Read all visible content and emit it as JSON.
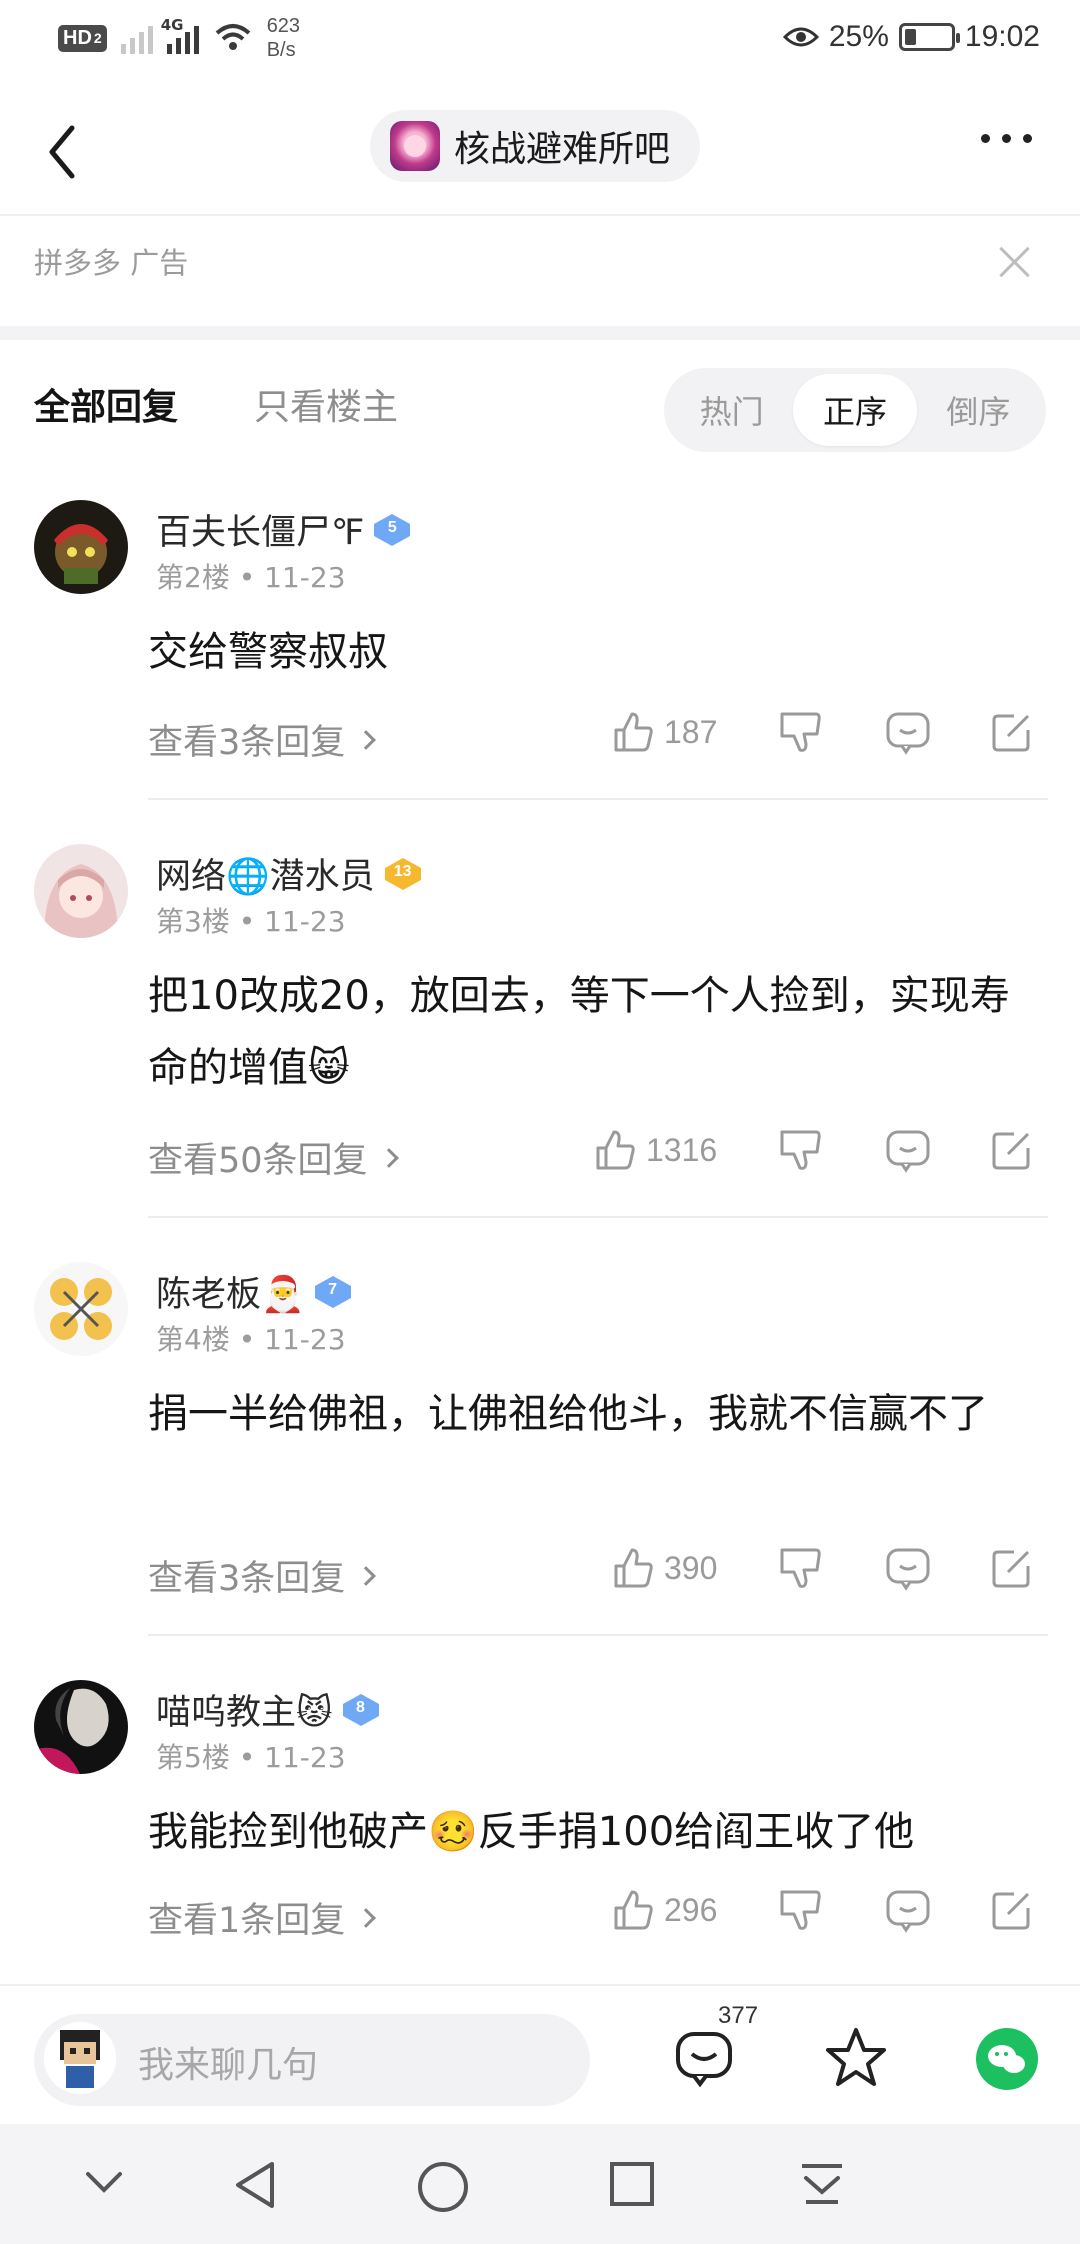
{
  "status_bar": {
    "hd_label": "HD",
    "hd_sub": "2",
    "network_type": "4G",
    "speed_value": "623",
    "speed_unit": "B/s",
    "battery_percent": "25%",
    "battery_level": 0.25,
    "time": "19:02",
    "icons": [
      "hd-icon",
      "signal-icon",
      "wifi-icon",
      "eye-icon",
      "battery-icon"
    ]
  },
  "header": {
    "forum_name": "核战避难所吧",
    "icons": [
      "back-icon",
      "more-icon"
    ]
  },
  "ad": {
    "label": "拼多多 广告"
  },
  "tabs": {
    "all_replies": "全部回复",
    "op_only": "只看楼主"
  },
  "sort": {
    "options": [
      "热门",
      "正序",
      "倒序"
    ],
    "selected": "正序"
  },
  "posts": [
    {
      "username": "百夫长僵尸℉",
      "level": "5",
      "level_color": "#6fa8f5",
      "floor": "第2楼",
      "date": "11-23",
      "content": "交给警察叔叔",
      "view_replies": "查看3条回复",
      "likes": "187"
    },
    {
      "username": "网络🌐潜水员",
      "level": "13",
      "level_color": "#f5b82e",
      "floor": "第3楼",
      "date": "11-23",
      "content": "把10改成20，放回去，等下一个人捡到，实现寿命的增值😸",
      "view_replies": "查看50条回复",
      "likes": "1316"
    },
    {
      "username": "陈老板🎅",
      "level": "7",
      "level_color": "#6fa8f5",
      "floor": "第4楼",
      "date": "11-23",
      "content": "捐一半给佛祖，让佛祖给他斗，我就不信赢不了",
      "view_replies": "查看3条回复",
      "likes": "390"
    },
    {
      "username": "喵呜教主😾",
      "level": "8",
      "level_color": "#6fa8f5",
      "floor": "第5楼",
      "date": "11-23",
      "content": "我能捡到他破产🥴反手捐100给阎王收了他",
      "view_replies": "查看1条回复",
      "likes": "296"
    }
  ],
  "bottom_bar": {
    "input_placeholder": "我来聊几句",
    "comment_count": "377",
    "icons": [
      "comment-icon",
      "star-icon",
      "wechat-icon"
    ]
  },
  "system_nav": {
    "icons": [
      "collapse-icon",
      "back-triangle-icon",
      "home-circle-icon",
      "recents-square-icon",
      "notification-pull-icon"
    ]
  }
}
